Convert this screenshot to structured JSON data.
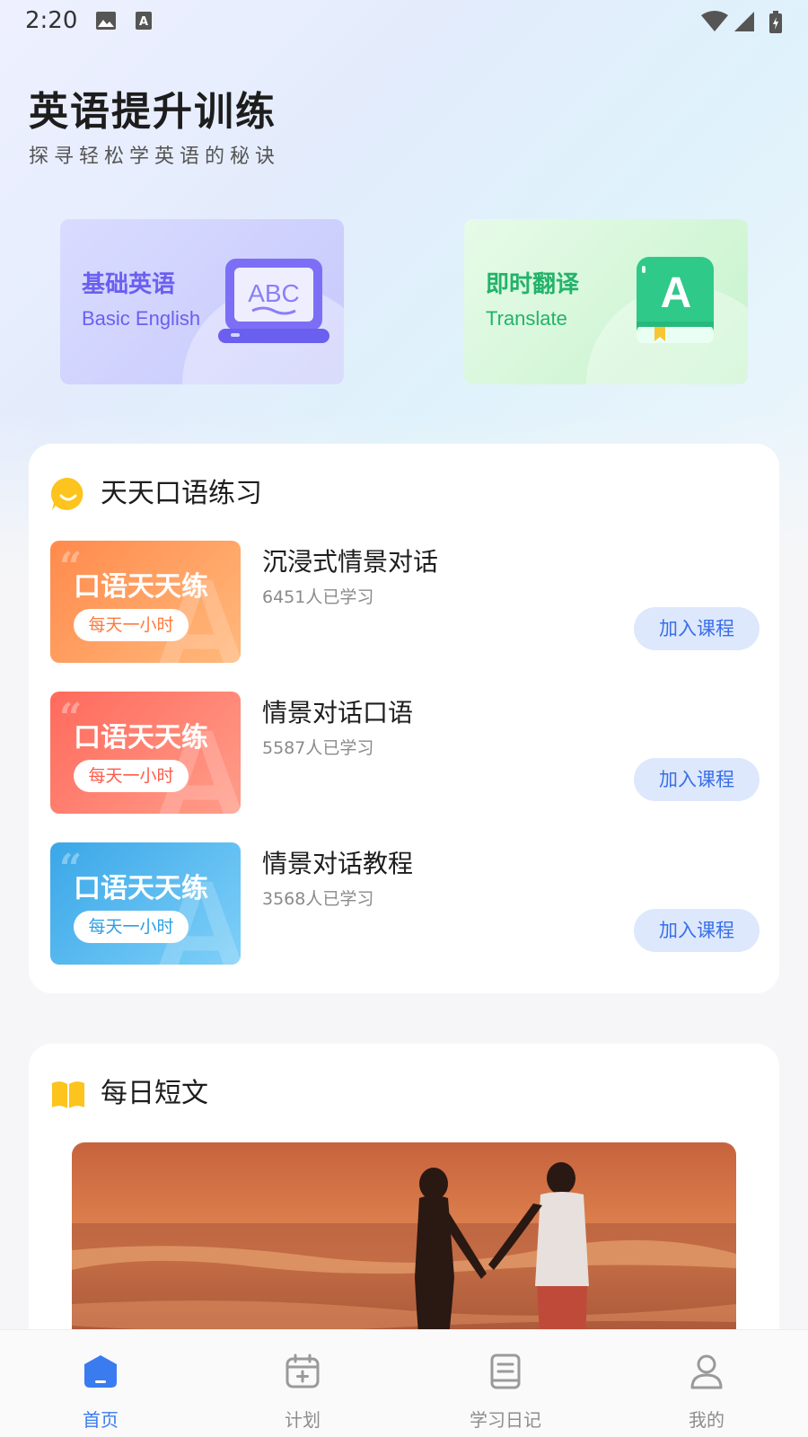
{
  "status_bar": {
    "time": "2:20"
  },
  "header": {
    "title": "英语提升训练",
    "subtitle": "探寻轻松学英语的秘诀"
  },
  "feature_cards": [
    {
      "title": "基础英语",
      "subtitle": "Basic English",
      "illustration": "laptop-abc-icon",
      "icon_text": "ABC"
    },
    {
      "title": "即时翻译",
      "subtitle": "Translate",
      "illustration": "book-a-icon",
      "icon_text": "A"
    }
  ],
  "speaking": {
    "title": "天天口语练习",
    "icon": "smile-bubble-icon",
    "courses": [
      {
        "name": "沉浸式情景对话",
        "count": "6451人已学习",
        "thumb_title": "口语天天练",
        "thumb_tag": "每天一小时",
        "button": "加入课程"
      },
      {
        "name": "情景对话口语",
        "count": "5587人已学习",
        "thumb_title": "口语天天练",
        "thumb_tag": "每天一小时",
        "button": "加入课程"
      },
      {
        "name": "情景对话教程",
        "count": "3568人已学习",
        "thumb_title": "口语天天练",
        "thumb_tag": "每天一小时",
        "button": "加入课程"
      }
    ]
  },
  "daily": {
    "title": "每日短文",
    "icon": "open-book-icon"
  },
  "tabs": [
    {
      "label": "首页",
      "icon": "home-icon",
      "active": true
    },
    {
      "label": "计划",
      "icon": "calendar-plus-icon",
      "active": false
    },
    {
      "label": "学习日记",
      "icon": "notebook-icon",
      "active": false
    },
    {
      "label": "我的",
      "icon": "user-icon",
      "active": false
    }
  ],
  "colors": {
    "accent": "#3a7bf0",
    "basic": "#6a5ff0",
    "translate": "#22b36a"
  }
}
